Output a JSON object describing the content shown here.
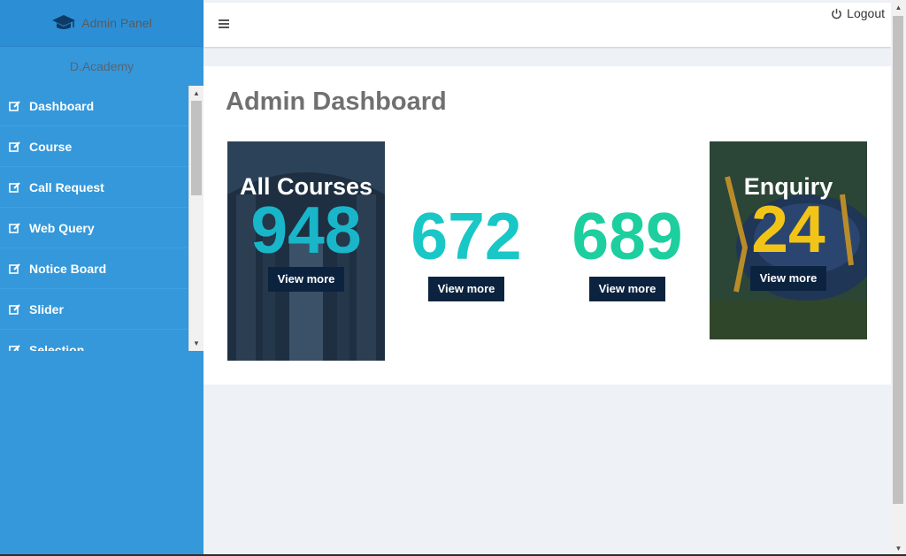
{
  "brand": {
    "title": "Admin Panel",
    "icon": "graduation-cap-icon"
  },
  "user": {
    "name": "D.Academy"
  },
  "sidebar": {
    "items": [
      {
        "label": "Dashboard",
        "icon": "edit-icon"
      },
      {
        "label": "Course",
        "icon": "edit-icon"
      },
      {
        "label": "Call Request",
        "icon": "edit-icon"
      },
      {
        "label": "Web Query",
        "icon": "edit-icon"
      },
      {
        "label": "Notice Board",
        "icon": "edit-icon"
      },
      {
        "label": "Slider",
        "icon": "edit-icon"
      },
      {
        "label": "Selection",
        "icon": "edit-icon"
      }
    ]
  },
  "topbar": {
    "logout_label": "Logout"
  },
  "main": {
    "title": "Admin Dashboard",
    "cards": [
      {
        "label": "All Courses",
        "value": "948",
        "button": "View more",
        "color": "#19b6c9"
      },
      {
        "label": "",
        "value": "672",
        "button": "View more",
        "color": "#18c7c6"
      },
      {
        "label": "",
        "value": "689",
        "button": "View more",
        "color": "#1dcf9e"
      },
      {
        "label": "Enquiry",
        "value": "24",
        "button": "View more",
        "color": "#f3c418"
      }
    ]
  },
  "colors": {
    "sidebar": "#3498db",
    "button": "#0c2340"
  }
}
